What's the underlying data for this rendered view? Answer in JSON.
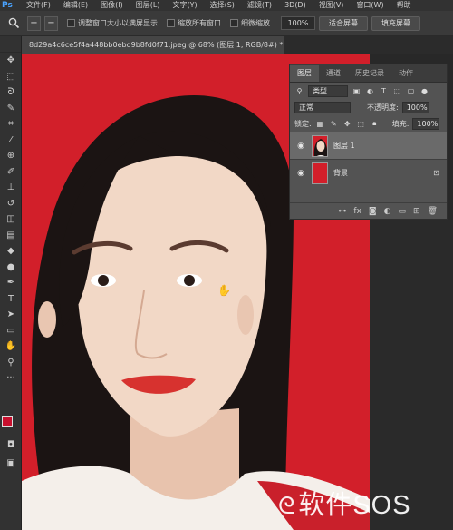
{
  "app": {
    "logo": "Ps"
  },
  "menu": [
    "文件(F)",
    "编辑(E)",
    "图像(I)",
    "图层(L)",
    "文字(Y)",
    "选择(S)",
    "滤镜(T)",
    "3D(D)",
    "视图(V)",
    "窗口(W)",
    "帮助"
  ],
  "options": {
    "checkbox_resize": "调整窗口大小以满屏显示",
    "checkbox_zoom_all": "缩放所有窗口",
    "checkbox_scrubby": "细微缩放",
    "zoom_value": "100%",
    "fit_screen": "适合屏幕",
    "fill_screen": "填充屏幕"
  },
  "document_tab": {
    "title": "8d29a4c6ce5f4a448bb0ebd9b8fd0f71.jpeg @ 68% (图层 1, RGB/8#) *",
    "close": "×"
  },
  "tools": [
    "move-icon",
    "marquee-icon",
    "lasso-icon",
    "quick-select-icon",
    "crop-icon",
    "eyedropper-icon",
    "healing-icon",
    "brush-icon",
    "stamp-icon",
    "history-brush-icon",
    "eraser-icon",
    "gradient-icon",
    "blur-icon",
    "dodge-icon",
    "pen-icon",
    "type-icon",
    "path-select-icon",
    "rectangle-icon",
    "hand-icon",
    "zoom-icon"
  ],
  "colors": {
    "foreground": "#c8102e",
    "background": "#ffffff",
    "photo_background": "#d21f2a"
  },
  "layers_panel": {
    "tabs": [
      "图层",
      "通道",
      "历史记录",
      "动作"
    ],
    "active_tab": "图层",
    "filter_kind": "类型",
    "blend_mode": "正常",
    "opacity_label": "不透明度:",
    "opacity_value": "100%",
    "lock_label": "锁定:",
    "fill_label": "填充:",
    "fill_value": "100%",
    "layers": [
      {
        "name": "图层 1",
        "visible": true,
        "selected": true
      },
      {
        "name": "背景",
        "visible": true,
        "selected": false,
        "locked": true
      }
    ]
  },
  "watermark": {
    "text": "软件SOS"
  }
}
